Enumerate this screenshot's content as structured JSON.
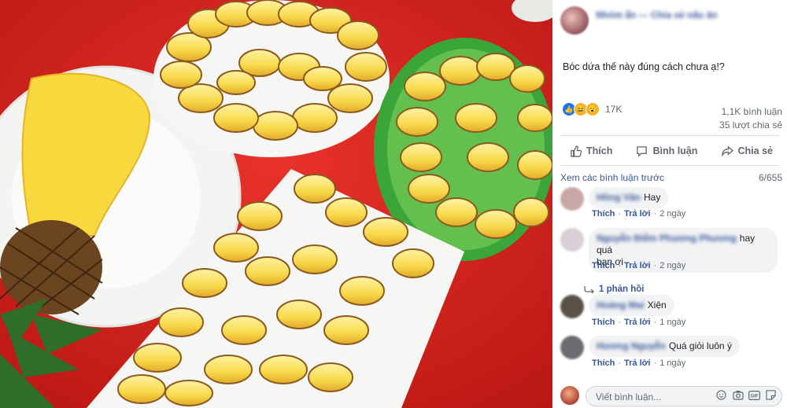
{
  "post": {
    "author_name": "Nhóm ẩn — Chia sẻ nấu ăn",
    "text": "Bóc dứa thế này đúng cách chưa ạ!?",
    "reaction_count": "17K",
    "comment_count": "1,1K bình luận",
    "share_count": "35 lượt chia sẻ"
  },
  "actions": {
    "like": "Thích",
    "comment": "Bình luận",
    "share": "Chia sẻ"
  },
  "comments_header": {
    "view_previous": "Xem các bình luận trước",
    "count": "6/655"
  },
  "comments": [
    {
      "name": "Hồng Vân",
      "text": "Hay",
      "like": "Thích",
      "reply": "Trả lời",
      "time": "2 ngày",
      "avatar_color": "#caa7a7"
    },
    {
      "name": "Nguyễn Điểm Phương Phương",
      "text": "hay quá",
      "text2": "bạn ơi",
      "like": "Thích",
      "reply": "Trả lời",
      "time": "2 ngày",
      "avatar_color": "#d9cfd6"
    },
    {
      "name": "Hoàng Mai",
      "text": "Xiện",
      "like": "Thích",
      "reply": "Trả lời",
      "time": "1 ngày",
      "avatar_color": "#5a5046"
    },
    {
      "name": "Hương Nguyễn",
      "text": "Quá giỏi luôn ý",
      "like": "Thích",
      "reply": "Trả lời",
      "time": "1 ngày",
      "avatar_color": "#6d6a70"
    }
  ],
  "replies_link": "1 phản hồi",
  "composer": {
    "placeholder": "Viết bình luận..."
  },
  "colors": {
    "link": "#385898",
    "meta": "#606770",
    "bubble": "#f2f3f5",
    "tablecloth": "#d7231c"
  }
}
